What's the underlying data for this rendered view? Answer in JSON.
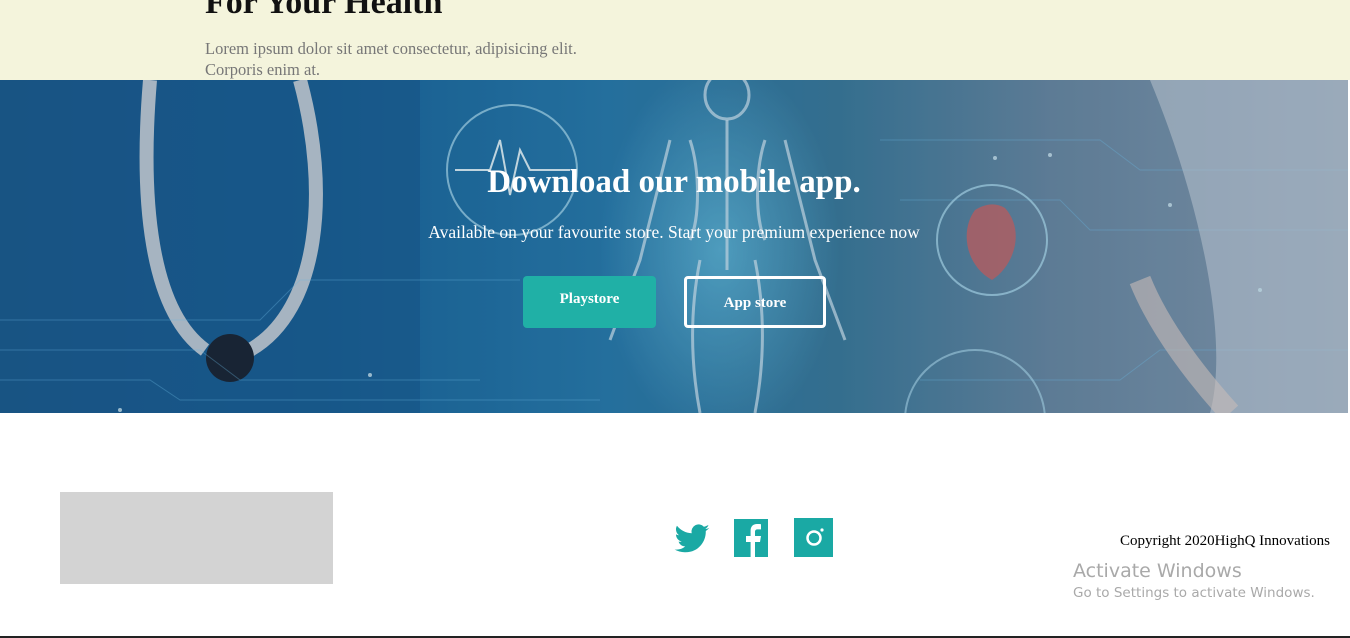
{
  "top_section": {
    "title": "For Your Health",
    "subtitle": "Lorem ipsum dolor sit amet consectetur, adipisicing elit. Corporis enim at."
  },
  "download_section": {
    "title": "Download our mobile app.",
    "subtitle": "Available on your favourite store. Start your premium experience now",
    "playstore_label": "Playstore",
    "appstore_label": "App store",
    "accent_color": "#20b0a6"
  },
  "footer": {
    "social_icons": [
      "twitter-icon",
      "facebook-icon",
      "instagram-icon"
    ],
    "copyright": "Copyright 2020HighQ Innovations",
    "icon_color": "#1aa9a4"
  },
  "os_overlay": {
    "activate_title": "Activate Windows",
    "activate_sub": "Go to Settings to activate Windows."
  }
}
